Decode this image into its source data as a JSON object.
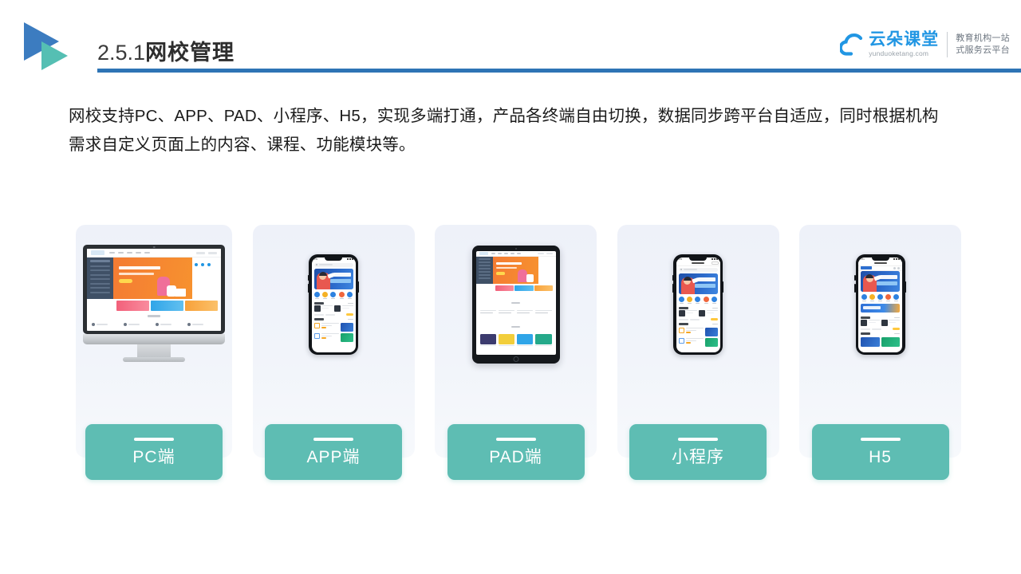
{
  "slide": {
    "header": {
      "section_number": "2.5.1",
      "title": "网校管理",
      "logo_icon": "double-triangle-play-icon",
      "rule_color": "#2E74B5"
    },
    "brand": {
      "cloud_icon": "cloud-icon",
      "name": "云朵课堂",
      "url": "yunduoketang.com",
      "tagline_line1": "教育机构一站",
      "tagline_line2": "式服务云平台",
      "accent_color": "#2196E3"
    },
    "body": {
      "paragraph_line1": "网校支持PC、APP、PAD、小程序、H5，实现多端打通，产品各终端自由切换，数据同步跨平台自适应，同时根据机构",
      "paragraph_line2": "需求自定义页面上的内容、课程、功能模块等。"
    },
    "cards": [
      {
        "label": "PC端",
        "device": "desktop-imac",
        "accent_color": "#5EBDB3",
        "card_bg": "#EEF1F9"
      },
      {
        "label": "APP端",
        "device": "smartphone",
        "accent_color": "#5EBDB3",
        "card_bg": "#EEF1F9"
      },
      {
        "label": "PAD端",
        "device": "tablet-ipad",
        "accent_color": "#5EBDB3",
        "card_bg": "#EEF1F9"
      },
      {
        "label": "小程序",
        "device": "smartphone-miniprogram",
        "accent_color": "#5EBDB3",
        "card_bg": "#EEF1F9"
      },
      {
        "label": "H5",
        "device": "smartphone-h5",
        "accent_color": "#5EBDB3",
        "card_bg": "#EEF1F9"
      }
    ]
  }
}
